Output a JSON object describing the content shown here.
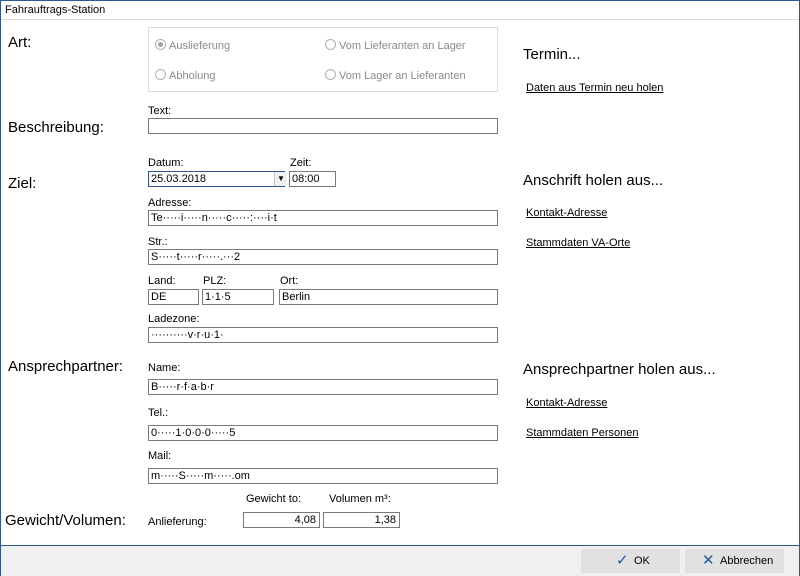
{
  "window": {
    "title": "Fahrauftrags-Station"
  },
  "sections": {
    "art": "Art:",
    "beschreibung": "Beschreibung:",
    "ziel": "Ziel:",
    "ansprechpartner": "Ansprechpartner:",
    "gewicht_volumen": "Gewicht/Volumen:"
  },
  "art": {
    "options": [
      {
        "label": "Auslieferung",
        "selected": true
      },
      {
        "label": "Vom Lieferanten an Lager",
        "selected": false
      },
      {
        "label": "Abholung",
        "selected": false
      },
      {
        "label": "Vom Lager an Lieferanten",
        "selected": false
      }
    ]
  },
  "beschreibung": {
    "text_label": "Text:",
    "text_value": ""
  },
  "ziel": {
    "datum_label": "Datum:",
    "datum_value": "25.03.2018",
    "zeit_label": "Zeit:",
    "zeit_value": "08:00",
    "adresse_label": "Adresse:",
    "adresse_value": "Te·····i·····n·····c·····:····i·t",
    "str_label": "Str.:",
    "str_value": "S·····t·····r·····.···2",
    "land_label": "Land:",
    "land_value": "DE",
    "plz_label": "PLZ:",
    "plz_value": "1·1·5",
    "ort_label": "Ort:",
    "ort_value": "Berlin",
    "ladezone_label": "Ladezone:",
    "ladezone_value": "··········v·r·u·1·"
  },
  "ansprechpartner": {
    "name_label": "Name:",
    "name_value": "B·····r·f·a·b·r",
    "tel_label": "Tel.:",
    "tel_value": "0·····1·0·0·0·····5",
    "mail_label": "Mail:",
    "mail_value": "m·····S·····m·····.om"
  },
  "gewicht": {
    "gewicht_label": "Gewicht to:",
    "volumen_label": "Volumen m³:",
    "anlieferung_label": "Anlieferung:",
    "gewicht_value": "4,08",
    "volumen_value": "1,38"
  },
  "right": {
    "termin_heading": "Termin...",
    "termin_link": "Daten aus Termin neu holen",
    "anschrift_heading": "Anschrift holen aus...",
    "anschrift_link1": "Kontakt-Adresse",
    "anschrift_link2": "Stammdaten VA-Orte",
    "ansprech_heading": "Ansprechpartner holen aus...",
    "ansprech_link1": "Kontakt-Adresse",
    "ansprech_link2": "Stammdaten Personen"
  },
  "footer": {
    "ok_label": "OK",
    "cancel_label": "Abbrechen"
  },
  "colors": {
    "window_border": "#2b5797",
    "ok_icon": "#1b5fa8",
    "cancel_icon": "#1b5fa8"
  },
  "icons": {
    "ok": "checkmark-icon",
    "cancel": "x-icon",
    "dropdown": "chevron-down-icon"
  }
}
